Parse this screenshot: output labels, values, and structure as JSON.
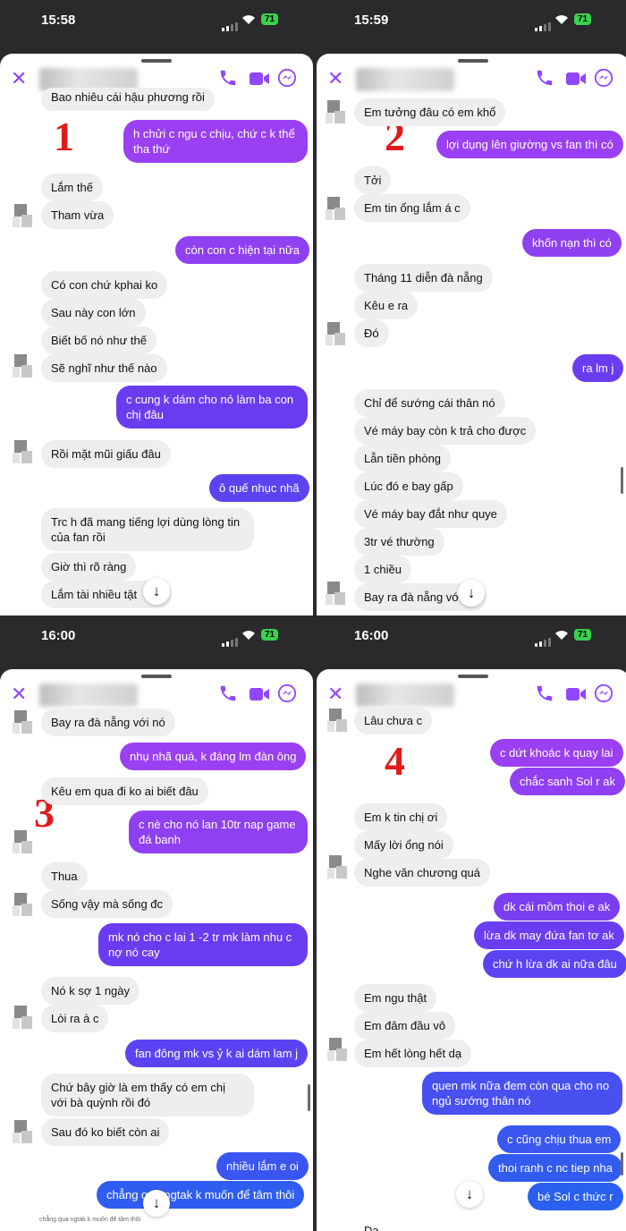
{
  "colors": {
    "accent": "#9146ff",
    "bubble_out": "#7b3cf0",
    "bubble_in": "#eeeef0",
    "number_red": "#e11b1b"
  },
  "icons": {
    "close": "close-icon",
    "call": "phone-icon",
    "video": "video-icon",
    "messenger": "messenger-icon",
    "scroll_down": "arrow-down-icon"
  },
  "panels": [
    {
      "time": "15:58",
      "battery": "71",
      "label": "1",
      "messages": [
        {
          "dir": "in",
          "text": "Bao nhiêu cái hậu phương rồi"
        },
        {
          "dir": "out",
          "text": "h chửi c ngu c chịu, chứ c k thể tha thứ"
        },
        {
          "dir": "in",
          "text": "Lắm thế"
        },
        {
          "dir": "in",
          "text": "Tham vừa"
        },
        {
          "dir": "out",
          "text": "còn con c hiện tại nữa"
        },
        {
          "dir": "in",
          "text": "Có con chứ kphai ko"
        },
        {
          "dir": "in",
          "text": "Sau này con lớn"
        },
        {
          "dir": "in",
          "text": "Biết bố nó như thế"
        },
        {
          "dir": "in",
          "text": "Sẽ nghĩ như thế nào"
        },
        {
          "dir": "out",
          "text": "c cung k dám cho nó làm ba con chị đâu"
        },
        {
          "dir": "in",
          "text": "Rồi mặt mũi giấu đâu"
        },
        {
          "dir": "out",
          "text": "ô quế nhục nhã"
        },
        {
          "dir": "in",
          "text": "Trc h đã mang tiếng lợi dùng lòng tin của fan rồi"
        },
        {
          "dir": "in",
          "text": "Giờ thì rõ ràng"
        },
        {
          "dir": "in",
          "text": "Lắm tài nhiều tật"
        }
      ]
    },
    {
      "time": "15:59",
      "battery": "71",
      "label": "2",
      "messages": [
        {
          "dir": "in",
          "text": "Em tưởng đâu có em khổ"
        },
        {
          "dir": "out",
          "text": "lợi dụng lên giường vs fan thì có"
        },
        {
          "dir": "in",
          "text": "Tởi"
        },
        {
          "dir": "in",
          "text": "Em tin ổng lắm á c"
        },
        {
          "dir": "out",
          "text": "khốn nạn thì có"
        },
        {
          "dir": "in",
          "text": "Tháng 11 diễn đà nẵng"
        },
        {
          "dir": "in",
          "text": "Kêu e ra"
        },
        {
          "dir": "in",
          "text": "Đó"
        },
        {
          "dir": "out",
          "text": "ra lm j"
        },
        {
          "dir": "in",
          "text": "Chỉ để sướng cái thân nó"
        },
        {
          "dir": "in",
          "text": "Vé máy bay còn k trả cho được"
        },
        {
          "dir": "in",
          "text": "Lẫn tiền phòng"
        },
        {
          "dir": "in",
          "text": "Lúc đó e bay gấp"
        },
        {
          "dir": "in",
          "text": "Vé máy bay đắt như quye"
        },
        {
          "dir": "in",
          "text": "3tr vé thường"
        },
        {
          "dir": "in",
          "text": "1 chiều"
        },
        {
          "dir": "in",
          "text": "Bay ra đà nẵng với"
        }
      ]
    },
    {
      "time": "16:00",
      "battery": "71",
      "label": "3",
      "messages": [
        {
          "dir": "in",
          "text": "Bay ra đà nẵng với nó"
        },
        {
          "dir": "out",
          "text": "nhụ nhã quá, k đáng lm đàn ông"
        },
        {
          "dir": "in",
          "text": "Kêu em qua đi ko ai biết đâu"
        },
        {
          "dir": "out",
          "text": "c nè cho nó lan 10tr nap game đá banh"
        },
        {
          "dir": "in",
          "text": "Thua"
        },
        {
          "dir": "in",
          "text": "Sống vậy mà sống đc"
        },
        {
          "dir": "out",
          "text": "mk nó cho c lai 1 -2 tr mk làm nhu c nợ nó cay"
        },
        {
          "dir": "in",
          "text": "Nó k sợ 1 ngày"
        },
        {
          "dir": "in",
          "text": "Lòi ra à c"
        },
        {
          "dir": "out",
          "text": "fan đông mk vs ỷ k ai dám lam j"
        },
        {
          "dir": "in",
          "text": "Chứ bây giờ là em thấy có em chị với bà quỳnh rồi đó"
        },
        {
          "dir": "in",
          "text": "Sau đó ko biết còn ai"
        },
        {
          "dir": "out",
          "text": "nhiều lắm e oi"
        },
        {
          "dir": "out",
          "text": "chẳng qua ngtak k muốn để tâm thôi"
        }
      ],
      "caption": "chẳng qua ngtak k muốn để tâm thôi"
    },
    {
      "time": "16:00",
      "battery": "71",
      "label": "4",
      "messages": [
        {
          "dir": "in",
          "text": "Lâu chưa c"
        },
        {
          "dir": "out",
          "text": "c dứt khoác k quay lai"
        },
        {
          "dir": "out",
          "text": "chắc sanh Sol r ak"
        },
        {
          "dir": "in",
          "text": "Em k tin chị ơi"
        },
        {
          "dir": "in",
          "text": "Mấy lời ổng nói"
        },
        {
          "dir": "in",
          "text": "Nghe văn chương quá"
        },
        {
          "dir": "out",
          "text": "dk cái mồm thoi e ak"
        },
        {
          "dir": "out",
          "text": "lừa dk may đứa fan tơ ak"
        },
        {
          "dir": "out",
          "text": "chứ h lừa dk ai nữa đâu"
        },
        {
          "dir": "in",
          "text": "Em ngu thật"
        },
        {
          "dir": "in",
          "text": "Em đâm đầu vô"
        },
        {
          "dir": "in",
          "text": "Em hết lòng hết dạ"
        },
        {
          "dir": "out",
          "text": "quen mk nữa đem còn qua cho no ngủ sướng thân nó"
        },
        {
          "dir": "out",
          "text": "c cũng chịu thua em"
        },
        {
          "dir": "out",
          "text": "thoi ranh c nc tiep nha"
        },
        {
          "dir": "out",
          "text": "bé Sol c thức r"
        },
        {
          "dir": "in",
          "text": "Da"
        }
      ]
    }
  ]
}
